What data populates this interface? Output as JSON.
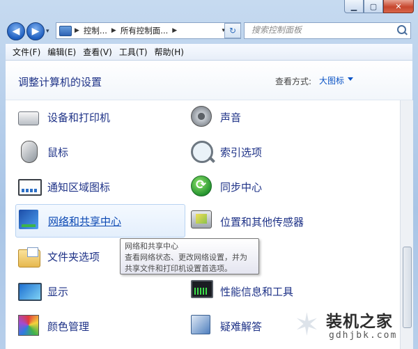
{
  "window": {
    "minimize_glyph": "▁",
    "maximize_glyph": "▢",
    "close_glyph": "✕"
  },
  "nav": {
    "back_glyph": "◀",
    "forward_glyph": "▶",
    "history_glyph": "▾",
    "breadcrumb": [
      "控制...",
      "所有控制面..."
    ],
    "breadcrumb_sep": "▶",
    "address_dropdown_glyph": "▾",
    "refresh_glyph": "↻",
    "search_placeholder": "搜索控制面板"
  },
  "menu": [
    "文件(F)",
    "编辑(E)",
    "查看(V)",
    "工具(T)",
    "帮助(H)"
  ],
  "header": {
    "title": "调整计算机的设置",
    "view_label": "查看方式:",
    "view_value": "大图标"
  },
  "items_left": [
    {
      "label": "设备和打印机",
      "icon": "printer-icon"
    },
    {
      "label": "鼠标",
      "icon": "mouse-icon"
    },
    {
      "label": "通知区域图标",
      "icon": "notification-tray-icon"
    },
    {
      "label": "网络和共享中心",
      "icon": "network-icon"
    },
    {
      "label": "文件夹选项",
      "icon": "folder-options-icon"
    },
    {
      "label": "显示",
      "icon": "display-icon"
    },
    {
      "label": "颜色管理",
      "icon": "color-management-icon"
    }
  ],
  "items_right": [
    {
      "label": "声音",
      "icon": "speaker-icon"
    },
    {
      "label": "索引选项",
      "icon": "indexing-icon"
    },
    {
      "label": "同步中心",
      "icon": "sync-center-icon"
    },
    {
      "label": "位置和其他传感器",
      "icon": "location-sensor-icon"
    },
    {
      "label": "",
      "icon": ""
    },
    {
      "label": "性能信息和工具",
      "icon": "performance-icon"
    },
    {
      "label": "疑难解答",
      "icon": "troubleshooting-icon"
    }
  ],
  "tooltip": {
    "title": "网络和共享中心",
    "line1": "查看网络状态、更改网络设置，并为",
    "line2": "共享文件和打印机设置首选项。"
  },
  "watermark": {
    "title": "装机之家",
    "url": "gdhjbk.com"
  },
  "colors": {
    "link": "#1e3287",
    "accent": "#0a53c5",
    "window_frame": "#a9c5e6"
  }
}
